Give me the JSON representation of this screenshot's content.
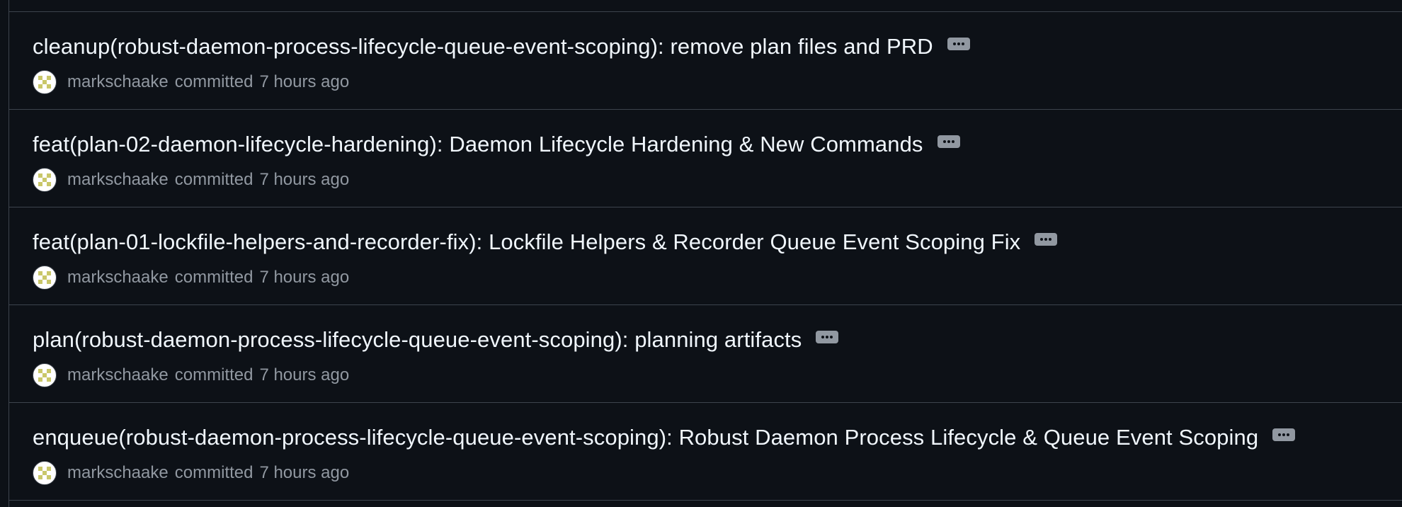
{
  "commits": [
    {
      "title": "cleanup(robust-daemon-process-lifecycle-queue-event-scoping): remove plan files and PRD",
      "author": "markschaake",
      "action": "committed",
      "time": "7 hours ago"
    },
    {
      "title": "feat(plan-02-daemon-lifecycle-hardening): Daemon Lifecycle Hardening & New Commands",
      "author": "markschaake",
      "action": "committed",
      "time": "7 hours ago"
    },
    {
      "title": "feat(plan-01-lockfile-helpers-and-recorder-fix): Lockfile Helpers & Recorder Queue Event Scoping Fix",
      "author": "markschaake",
      "action": "committed",
      "time": "7 hours ago"
    },
    {
      "title": "plan(robust-daemon-process-lifecycle-queue-event-scoping): planning artifacts",
      "author": "markschaake",
      "action": "committed",
      "time": "7 hours ago"
    },
    {
      "title": "enqueue(robust-daemon-process-lifecycle-queue-event-scoping): Robust Daemon Process Lifecycle & Queue Event Scoping",
      "author": "markschaake",
      "action": "committed",
      "time": "7 hours ago"
    }
  ],
  "icons": {
    "more": "ellipsis-icon",
    "avatar": "user-avatar-icon"
  },
  "colors": {
    "background": "#0d1117",
    "title": "#f0f6fc",
    "muted": "#9198a1",
    "border": "#3d444d"
  }
}
